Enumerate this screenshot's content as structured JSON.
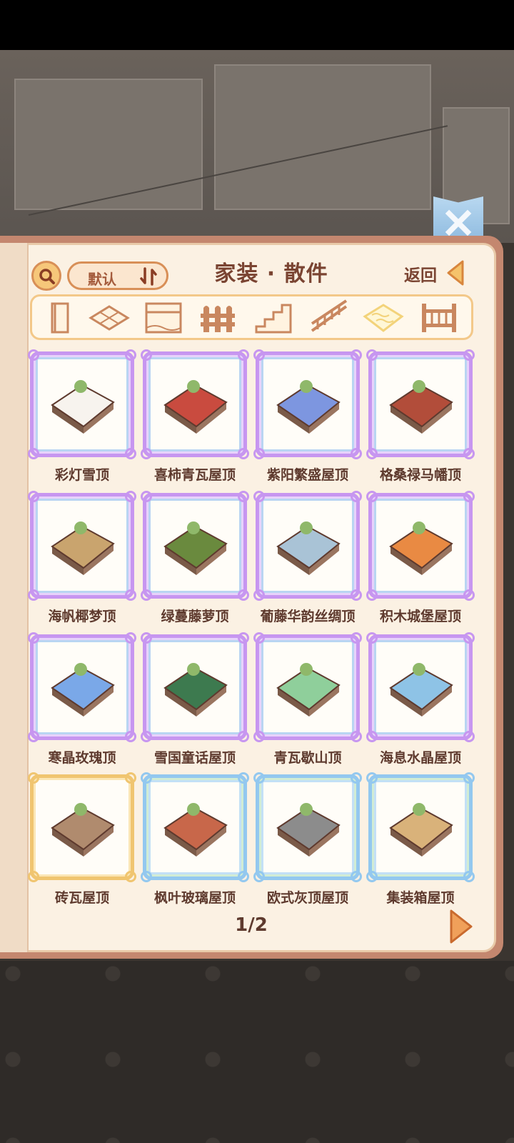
{
  "header": {
    "sort_label": "默认",
    "title": "家装 · 散件",
    "back_label": "返回"
  },
  "tabs": [
    {
      "icon": "door-icon",
      "selected": false
    },
    {
      "icon": "floor-tile-icon",
      "selected": false
    },
    {
      "icon": "wallpaper-icon",
      "selected": false
    },
    {
      "icon": "fence-icon",
      "selected": false
    },
    {
      "icon": "stairs-icon",
      "selected": false
    },
    {
      "icon": "railing-icon",
      "selected": false
    },
    {
      "icon": "roof-icon",
      "selected": true
    },
    {
      "icon": "gate-icon",
      "selected": false
    }
  ],
  "items": [
    {
      "label": "彩灯雪顶",
      "frame": "purple",
      "color": "#f7f3ee"
    },
    {
      "label": "喜柿青瓦屋顶",
      "frame": "purple",
      "color": "#c94b3f"
    },
    {
      "label": "紫阳繁盛屋顶",
      "frame": "purple",
      "color": "#7d96e0"
    },
    {
      "label": "格桑禄马幡顶",
      "frame": "purple",
      "color": "#b24d3a"
    },
    {
      "label": "海帆椰梦顶",
      "frame": "purple",
      "color": "#c9a46e"
    },
    {
      "label": "绿蔓藤萝顶",
      "frame": "purple",
      "color": "#6a8a3e"
    },
    {
      "label": "葡藤华韵丝绸顶",
      "frame": "purple",
      "color": "#a9c3d6"
    },
    {
      "label": "积木城堡屋顶",
      "frame": "purple",
      "color": "#e98a43"
    },
    {
      "label": "寒晶玫瑰顶",
      "frame": "purple",
      "color": "#7aa8e8"
    },
    {
      "label": "雪国童话屋顶",
      "frame": "purple",
      "color": "#3d7a4f"
    },
    {
      "label": "青瓦歇山顶",
      "frame": "purple",
      "color": "#8fcf9b"
    },
    {
      "label": "海息水晶屋顶",
      "frame": "purple",
      "color": "#8ec3e6"
    },
    {
      "label": "砖瓦屋顶",
      "frame": "gold",
      "color": "#b08b6e"
    },
    {
      "label": "枫叶玻璃屋顶",
      "frame": "blue",
      "color": "#c8674a"
    },
    {
      "label": "欧式灰顶屋顶",
      "frame": "blue",
      "color": "#8c8c8c"
    },
    {
      "label": "集装箱屋顶",
      "frame": "blue",
      "color": "#d9b27a"
    }
  ],
  "pager": {
    "text": "1/2"
  },
  "colors": {
    "panel_bg": "#fbf1e3",
    "panel_border": "#c4876f",
    "title_text": "#7a4432",
    "accent_orange": "#e58c4b"
  }
}
